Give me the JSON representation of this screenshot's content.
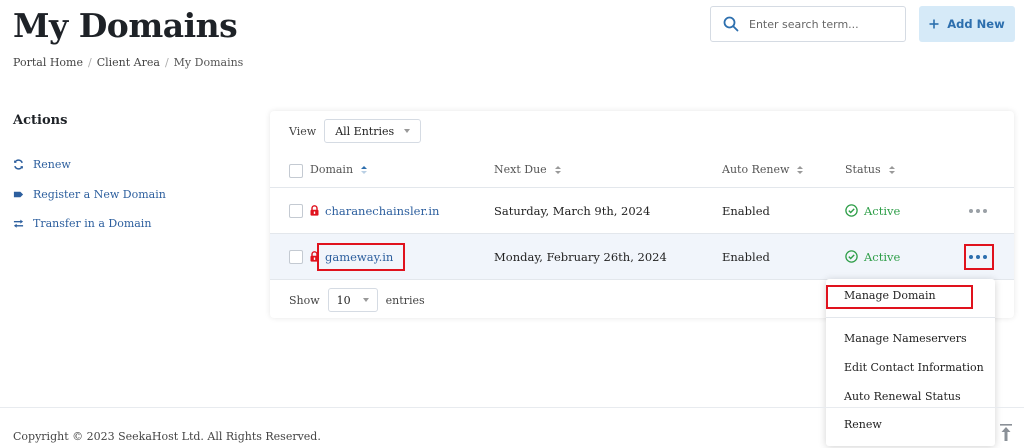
{
  "header": {
    "title": "My Domains",
    "breadcrumb": [
      "Portal Home",
      "Client Area",
      "My Domains"
    ],
    "search_placeholder": "Enter search term...",
    "add_new_label": "Add New"
  },
  "sidebar": {
    "title": "Actions",
    "items": [
      {
        "label": "Renew",
        "icon": "sync-icon"
      },
      {
        "label": "Register a New Domain",
        "icon": "tag-icon"
      },
      {
        "label": "Transfer in a Domain",
        "icon": "exchange-icon"
      }
    ]
  },
  "table": {
    "view_label": "View",
    "view_selected": "All Entries",
    "columns": [
      "Domain",
      "Next Due",
      "Auto Renew",
      "Status"
    ],
    "rows": [
      {
        "domain": "charanechainsler.in",
        "next_due": "Saturday, March 9th, 2024",
        "auto_renew": "Enabled",
        "status": "Active"
      },
      {
        "domain": "gameway.in",
        "next_due": "Monday, February 26th, 2024",
        "auto_renew": "Enabled",
        "status": "Active"
      }
    ],
    "show_label": "Show",
    "show_count": "10",
    "entries_label": "entries"
  },
  "dropdown": {
    "items": [
      "Manage Domain",
      "Manage Nameservers",
      "Edit Contact Information",
      "Auto Renewal Status",
      "Renew"
    ]
  },
  "footer": {
    "copyright": "Copyright © 2023 SeekaHost Ltd. All Rights Reserved."
  },
  "colors": {
    "accent": "#2d6fae",
    "link": "#2d5f9e",
    "active_green": "#2e9e48",
    "lock_red": "#e0121d",
    "highlight_red": "#e0121d"
  }
}
